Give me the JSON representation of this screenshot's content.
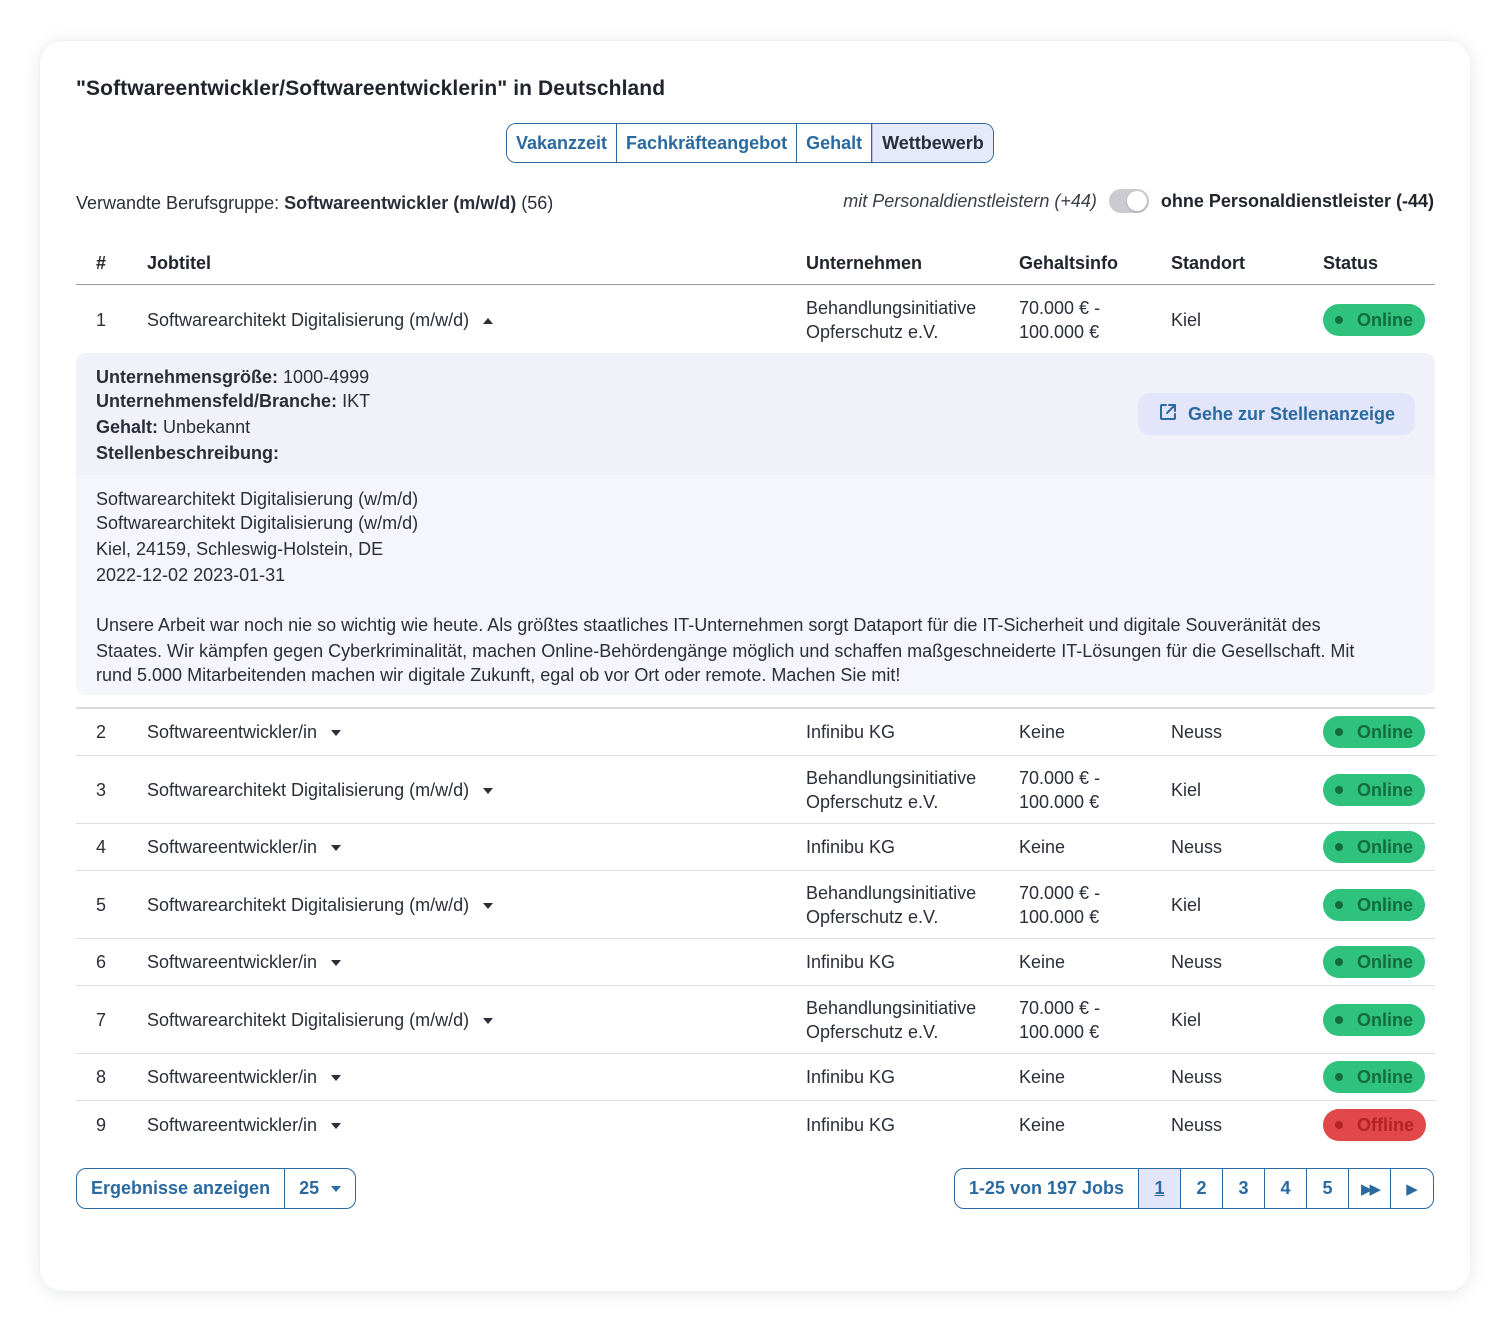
{
  "title": "\"Softwareentwickler/Softwareentwicklerin\" in Deutschland",
  "tabs": [
    "Vakanzzeit",
    "Fachkräfteangebot",
    "Gehalt",
    "Wettbewerb"
  ],
  "group": {
    "label": "Verwandte Berufsgruppe:",
    "name": "Softwareentwickler (m/w/d)",
    "count": "(56)"
  },
  "toggle": {
    "left": "mit Personaldienstleistern (+44)",
    "right": "ohne Personaldienstleister (-44)"
  },
  "columns": {
    "num": "#",
    "job": "Jobtitel",
    "company": "Unternehmen",
    "salary": "Gehaltsinfo",
    "location": "Standort",
    "status": "Status"
  },
  "rows": [
    {
      "num": "1",
      "job": "Softwarearchitekt Digitalisierung (m/w/d)",
      "company1": "Behandlungsinitiative",
      "company2": "Opferschutz e.V.",
      "salary1": "70.000 € -",
      "salary2": "100.000 €",
      "location": "Kiel",
      "status": "Online"
    },
    {
      "num": "2",
      "job": "Softwareentwickler/in",
      "company1": "Infinibu KG",
      "company2": "",
      "salary1": "Keine",
      "salary2": "",
      "location": "Neuss",
      "status": "Online"
    },
    {
      "num": "3",
      "job": "Softwarearchitekt Digitalisierung (m/w/d)",
      "company1": "Behandlungsinitiative",
      "company2": "Opferschutz e.V.",
      "salary1": "70.000 € -",
      "salary2": "100.000 €",
      "location": "Kiel",
      "status": "Online"
    },
    {
      "num": "4",
      "job": "Softwareentwickler/in",
      "company1": "Infinibu KG",
      "company2": "",
      "salary1": "Keine",
      "salary2": "",
      "location": "Neuss",
      "status": "Online"
    },
    {
      "num": "5",
      "job": "Softwarearchitekt Digitalisierung (m/w/d)",
      "company1": "Behandlungsinitiative",
      "company2": "Opferschutz e.V.",
      "salary1": "70.000 € -",
      "salary2": "100.000 €",
      "location": "Kiel",
      "status": "Online"
    },
    {
      "num": "6",
      "job": "Softwareentwickler/in",
      "company1": "Infinibu KG",
      "company2": "",
      "salary1": "Keine",
      "salary2": "",
      "location": "Neuss",
      "status": "Online"
    },
    {
      "num": "7",
      "job": "Softwarearchitekt Digitalisierung (m/w/d)",
      "company1": "Behandlungsinitiative",
      "company2": "Opferschutz e.V.",
      "salary1": "70.000 € -",
      "salary2": "100.000 €",
      "location": "Kiel",
      "status": "Online"
    },
    {
      "num": "8",
      "job": "Softwareentwickler/in",
      "company1": "Infinibu KG",
      "company2": "",
      "salary1": "Keine",
      "salary2": "",
      "location": "Neuss",
      "status": "Online"
    },
    {
      "num": "9",
      "job": "Softwareentwickler/in",
      "company1": "Infinibu KG",
      "company2": "",
      "salary1": "Keine",
      "salary2": "",
      "location": "Neuss",
      "status": "Offline"
    }
  ],
  "detail": {
    "size_label": "Unternehmensgröße:",
    "size": "1000-4999",
    "field_label": "Unternehmensfeld/Branche:",
    "field": "IKT",
    "salary_label": "Gehalt:",
    "salary": "Unbekannt",
    "desc_label": "Stellenbeschreibung:",
    "goto": "Gehe zur Stellenanzeige",
    "lines": [
      "Softwarearchitekt Digitalisierung (w/m/d)",
      "Softwarearchitekt Digitalisierung (w/m/d)",
      "Kiel, 24159, Schleswig-Holstein, DE",
      "2022-12-02 2023-01-31"
    ],
    "paragraph": [
      "Unsere Arbeit war noch nie so wichtig wie heute. Als größtes staatliches IT-Unternehmen sorgt Dataport für die IT-Sicherheit und digitale Souveränität des",
      "Staates. Wir kämpfen gegen Cyberkriminalität, machen Online-Behördengänge möglich und schaffen maßgeschneiderte IT-Lösungen für die Gesellschaft. Mit",
      "rund 5.000 Mitarbeitenden machen wir digitale Zukunft, egal ob vor Ort oder remote. Machen Sie mit!"
    ]
  },
  "footer": {
    "results_label": "Ergebnisse anzeigen",
    "per_page": "25"
  },
  "pager": {
    "info": "1-25 von 197 Jobs",
    "pages": [
      "1",
      "2",
      "3",
      "4",
      "5"
    ],
    "fast_forward": "▶▶",
    "next": "▶"
  },
  "colors": {
    "accent": "#2a6aa0",
    "online": "#2fc27c",
    "offline": "#e2474a",
    "tab_active_bg": "#e6e8fb"
  }
}
